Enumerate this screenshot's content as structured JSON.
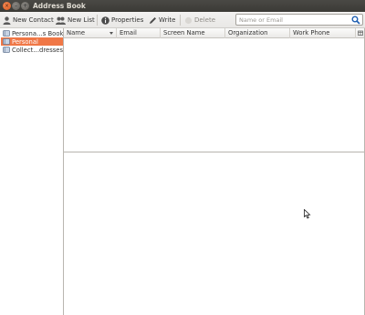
{
  "window": {
    "title": "Address Book",
    "buttons": {
      "close": "×",
      "minimize": "–",
      "maximize": "+"
    }
  },
  "toolbar": {
    "new_contact": "New Contact",
    "new_list": "New List",
    "properties": "Properties",
    "write": "Write",
    "delete": "Delete",
    "search_placeholder": "Name or Email",
    "search_value": ""
  },
  "sidebar": {
    "items": [
      {
        "label": "Persona…s Book",
        "selected": false
      },
      {
        "label": "Personal",
        "selected": true
      },
      {
        "label": "Collect…dresses",
        "selected": false
      }
    ]
  },
  "table": {
    "columns": [
      "Name",
      "Email",
      "Screen Name",
      "Organization",
      "Work Phone"
    ],
    "sort_column": "Name",
    "rows": []
  },
  "colors": {
    "accent": "#f07746",
    "titlebar": "#3c3b37",
    "search_icon": "#1e5eb0"
  }
}
